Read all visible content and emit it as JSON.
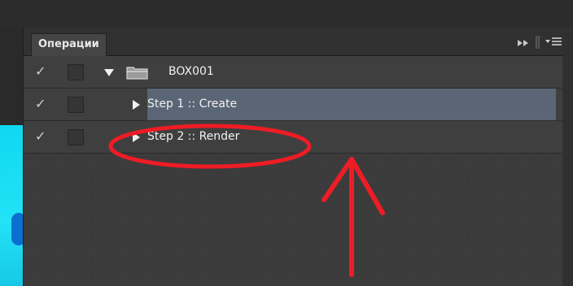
{
  "panel": {
    "tab_label": "Операции",
    "controls": {
      "collapse_icon": "double-chevron-right-icon",
      "menu_icon": "panel-menu-icon"
    }
  },
  "actions": [
    {
      "label": "BOX001",
      "type": "set",
      "expanded": true,
      "checked": true,
      "selected": false
    },
    {
      "label": "Step 1 :: Create",
      "type": "action",
      "expanded": false,
      "checked": true,
      "selected": true
    },
    {
      "label": "Step 2 :: Render",
      "type": "action",
      "expanded": false,
      "checked": true,
      "selected": false
    }
  ],
  "colors": {
    "panel_bg": "#3a3a3a",
    "selected_row": "#5a6675",
    "annotation_red": "#ee1c25",
    "canvas_cyan": "#22e2f6"
  }
}
